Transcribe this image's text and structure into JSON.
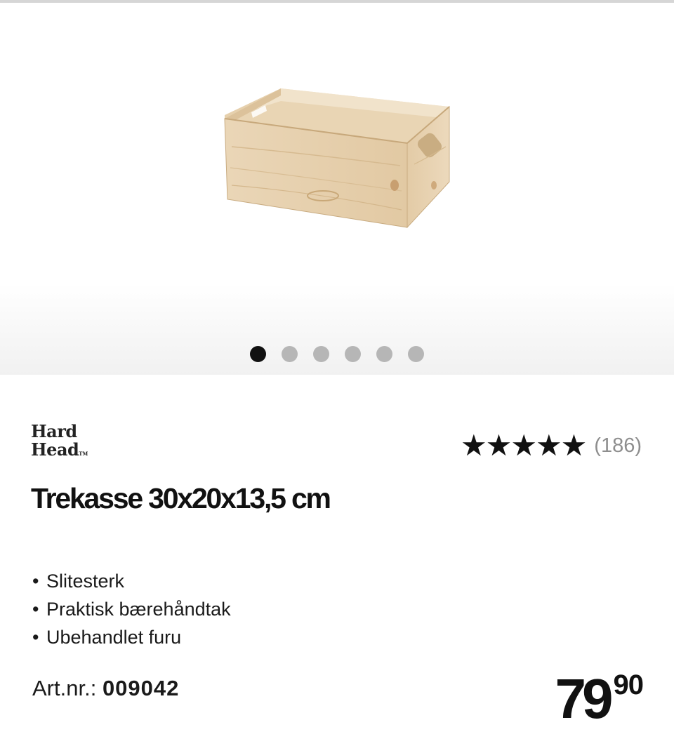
{
  "product": {
    "brand": {
      "line1": "Hard",
      "line2": "Head",
      "trademark": "TM"
    },
    "rating": {
      "stars_display": "★★★★★",
      "stars": 5,
      "count_text": "(186)"
    },
    "title": "Trekasse 30x20x13,5 cm",
    "features": [
      "Slitesterk",
      "Praktisk bærehåndtak",
      "Ubehandlet furu"
    ],
    "bullet": "•",
    "article_label": "Art.nr.:",
    "article_number": "009042",
    "price": {
      "whole": "79",
      "decimals": "90"
    }
  },
  "gallery": {
    "image_icon": "wooden-crate-image",
    "slides": 6,
    "active_slide": 1
  },
  "colors": {
    "text": "#111111",
    "muted": "#8e8e8e",
    "dot_inactive": "#b6b6b6",
    "dot_active": "#111111"
  }
}
